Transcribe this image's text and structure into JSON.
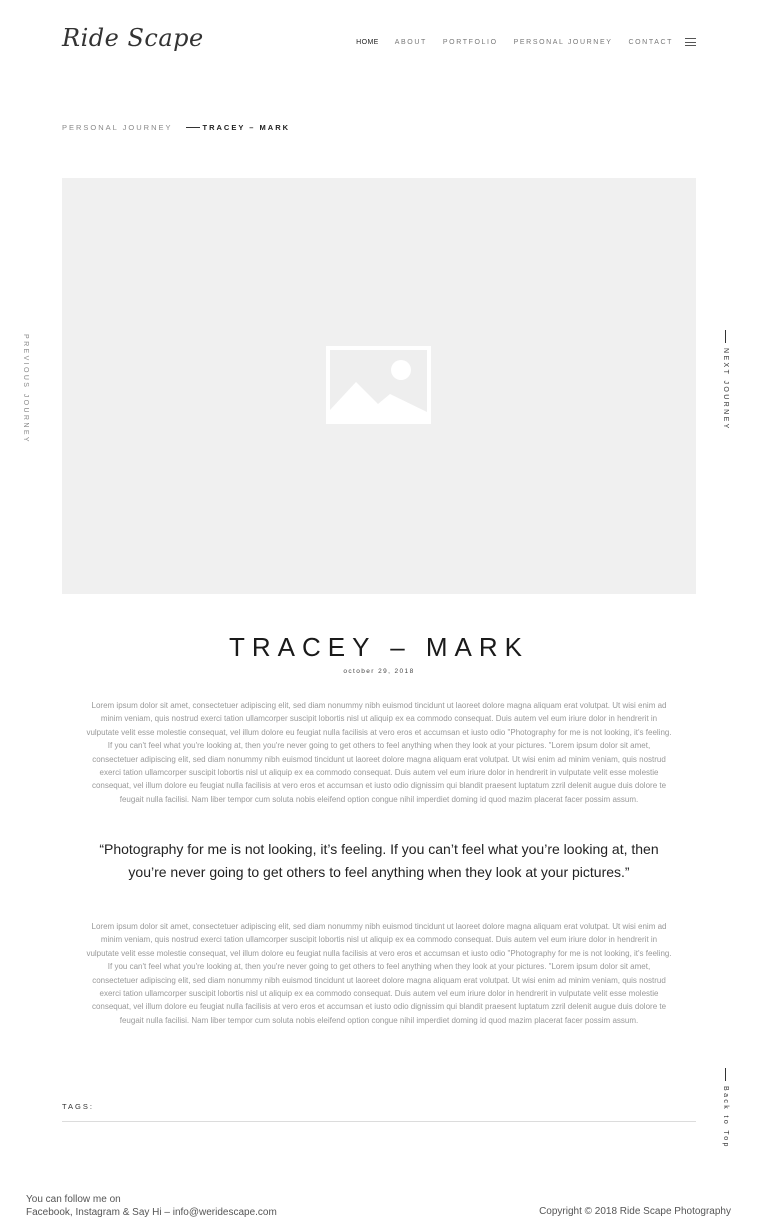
{
  "header": {
    "logo": "Ride Scape",
    "nav": [
      "HOME",
      "ABOUT",
      "PORTFOLIO",
      "PERSONAL JOURNEY",
      "CONTACT"
    ]
  },
  "breadcrumb": {
    "parent": "PERSONAL JOURNEY",
    "current": "TRACEY – MARK"
  },
  "side_nav": {
    "previous": "PREVIOUS JOURNEY",
    "next": "NEXT JOURNEY",
    "back_to_top": "Back to Top"
  },
  "post": {
    "title": "TRACEY – MARK",
    "date": "october 29, 2018",
    "paragraph_1": "Lorem ipsum dolor sit amet, consectetuer adipiscing elit, sed diam nonummy nibh euismod tincidunt ut laoreet dolore magna aliquam erat volutpat. Ut wisi enim ad minim veniam, quis nostrud exerci tation ullamcorper suscipit lobortis nisl ut aliquip ex ea commodo consequat. Duis autem vel eum iriure dolor in hendrerit in vulputate velit esse molestie consequat, vel illum dolore eu feugiat nulla facilisis at vero eros et accumsan et iusto odio \"Photography for me is not looking, it's feeling. If you can't feel what you're looking at, then you're never going to get others to feel anything when they look at your pictures. \"Lorem ipsum dolor sit amet, consectetuer adipiscing elit, sed diam nonummy nibh euismod tincidunt ut laoreet dolore magna aliquam erat volutpat. Ut wisi enim ad minim veniam, quis nostrud exerci tation ullamcorper suscipit lobortis nisl ut aliquip ex ea commodo consequat. Duis autem vel eum iriure dolor in hendrerit in vulputate velit esse molestie consequat, vel illum dolore eu feugiat nulla facilisis at vero eros et accumsan et iusto odio dignissim qui blandit praesent luptatum zzril delenit augue duis dolore te feugait nulla facilisi. Nam liber tempor cum soluta nobis eleifend option congue nihil imperdiet doming id quod mazim placerat facer possim assum.",
    "quote": "“Photography for me is not looking, it’s feeling. If you can’t feel what you’re looking at, then you’re never going to get others to feel anything when they look at your pictures.”",
    "paragraph_2": "Lorem ipsum dolor sit amet, consectetuer adipiscing elit, sed diam nonummy nibh euismod tincidunt ut laoreet dolore magna aliquam erat volutpat. Ut wisi enim ad minim veniam, quis nostrud exerci tation ullamcorper suscipit lobortis nisl ut aliquip ex ea commodo consequat. Duis autem vel eum iriure dolor in hendrerit in vulputate velit esse molestie consequat, vel illum dolore eu feugiat nulla facilisis at vero eros et accumsan et iusto odio \"Photography for me is not looking, it's feeling. If you can't feel what you're looking at, then you're never going to get others to feel anything when they look at your pictures. \"Lorem ipsum dolor sit amet, consectetuer adipiscing elit, sed diam nonummy nibh euismod tincidunt ut laoreet dolore magna aliquam erat volutpat. Ut wisi enim ad minim veniam, quis nostrud exerci tation ullamcorper suscipit lobortis nisl ut aliquip ex ea commodo consequat. Duis autem vel eum iriure dolor in hendrerit in vulputate velit esse molestie consequat, vel illum dolore eu feugiat nulla facilisis at vero eros et accumsan et iusto odio dignissim qui blandit praesent luptatum zzril delenit augue duis dolore te feugait nulla facilisi. Nam liber tempor cum soluta nobis eleifend option congue nihil imperdiet doming id quod mazim placerat facer possim assum.",
    "tags_label": "TAGS:"
  },
  "footer": {
    "follow_line": "You can follow me on",
    "contact_line": "Facebook, Instagram & Say Hi – info@weridescape.com",
    "copyright": "Copyright © 2018 Ride Scape Photography"
  },
  "icons": {
    "menu": "hamburger-menu-icon",
    "featured_image": "image-placeholder-icon"
  },
  "colors": {
    "text_dark": "#1a1a1a",
    "text_muted": "#999999",
    "image_bg": "#f0f0f0",
    "divider": "#dcdcdc"
  }
}
